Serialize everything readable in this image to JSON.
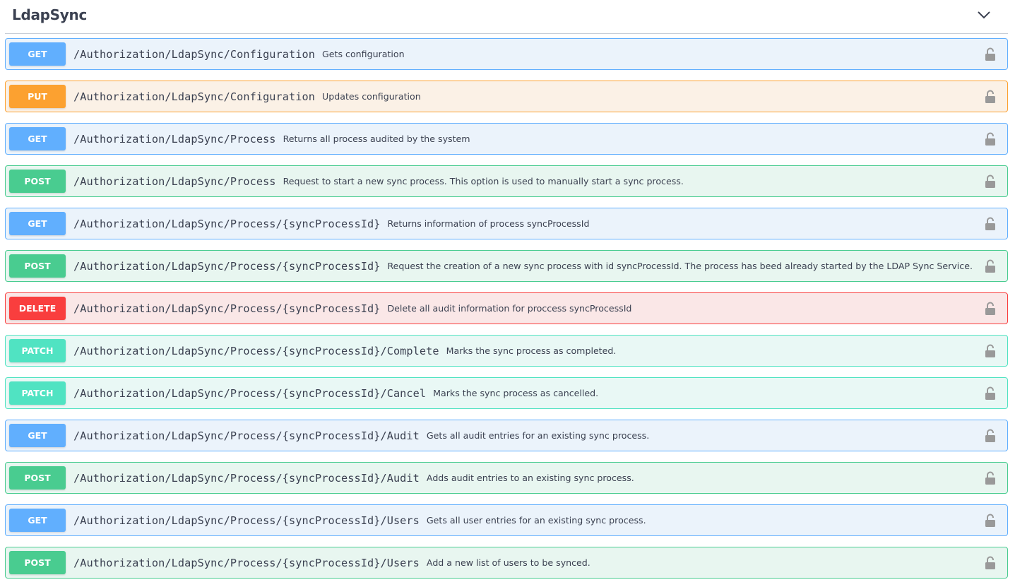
{
  "tag": {
    "title": "LdapSync",
    "toggle_icon": "chevron-down-icon"
  },
  "operations": [
    {
      "method": "GET",
      "kind": "get",
      "path": "/Authorization/LdapSync/Configuration",
      "summary": "Gets configuration"
    },
    {
      "method": "PUT",
      "kind": "put",
      "path": "/Authorization/LdapSync/Configuration",
      "summary": "Updates configuration"
    },
    {
      "method": "GET",
      "kind": "get",
      "path": "/Authorization/LdapSync/Process",
      "summary": "Returns all process audited by the system"
    },
    {
      "method": "POST",
      "kind": "post",
      "path": "/Authorization/LdapSync/Process",
      "summary": "Request to start a new sync process. This option is used to manually start a sync process."
    },
    {
      "method": "GET",
      "kind": "get",
      "path": "/Authorization/LdapSync/Process/{syncProcessId}",
      "summary": "Returns information of process syncProcessId"
    },
    {
      "method": "POST",
      "kind": "post",
      "path": "/Authorization/LdapSync/Process/{syncProcessId}",
      "summary": "Request the creation of a new sync process with id syncProcessId. The process has beed already started by the LDAP Sync Service."
    },
    {
      "method": "DELETE",
      "kind": "delete",
      "path": "/Authorization/LdapSync/Process/{syncProcessId}",
      "summary": "Delete all audit information for proccess syncProcessId"
    },
    {
      "method": "PATCH",
      "kind": "patch",
      "path": "/Authorization/LdapSync/Process/{syncProcessId}/Complete",
      "summary": "Marks the sync process as completed."
    },
    {
      "method": "PATCH",
      "kind": "patch",
      "path": "/Authorization/LdapSync/Process/{syncProcessId}/Cancel",
      "summary": "Marks the sync process as cancelled."
    },
    {
      "method": "GET",
      "kind": "get",
      "path": "/Authorization/LdapSync/Process/{syncProcessId}/Audit",
      "summary": "Gets all audit entries for an existing sync process."
    },
    {
      "method": "POST",
      "kind": "post",
      "path": "/Authorization/LdapSync/Process/{syncProcessId}/Audit",
      "summary": "Adds audit entries to an existing sync process."
    },
    {
      "method": "GET",
      "kind": "get",
      "path": "/Authorization/LdapSync/Process/{syncProcessId}/Users",
      "summary": "Gets all user entries for an existing sync process."
    },
    {
      "method": "POST",
      "kind": "post",
      "path": "/Authorization/LdapSync/Process/{syncProcessId}/Users",
      "summary": "Add a new list of users to be synced."
    }
  ],
  "lock_icon": "unlocked-padlock-icon",
  "colors": {
    "get": "#61affe",
    "put": "#fca130",
    "post": "#49cc90",
    "delete": "#f93e3e",
    "patch": "#50e3c2",
    "text": "#3b4151",
    "lock": "#999999"
  }
}
